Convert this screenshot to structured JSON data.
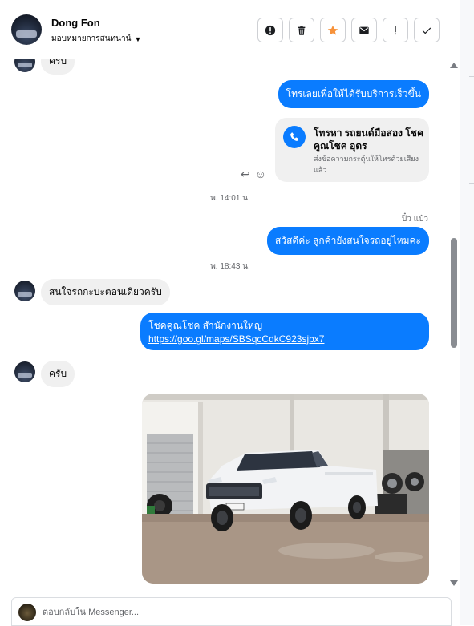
{
  "header": {
    "name": "Dong Fon",
    "assign_label": "มอบหมายการสนทนาน์",
    "tools": [
      {
        "icon": "alert-circle-icon",
        "glyph": "!"
      },
      {
        "icon": "trash-icon",
        "glyph": ""
      },
      {
        "icon": "star-icon",
        "glyph": "★",
        "color": "#f7923a"
      },
      {
        "icon": "mail-icon",
        "glyph": "✉"
      },
      {
        "icon": "exclamation-icon",
        "glyph": "!"
      },
      {
        "icon": "check-icon",
        "glyph": "✓"
      }
    ]
  },
  "messages": {
    "partial_top": "ครับ",
    "out_1": "โทรเลยเพื่อให้ได้รับบริการเร็วขึ้น",
    "call_card": {
      "title": "โทรหา รถยนต์มือสอง โชคคูณโชค อุดร",
      "subtitle": "ส่งข้อความกระตุ้นให้โทรด้วยเสียงแล้ว"
    },
    "stamp_1": "พ. 14:01 น.",
    "sender_1": "ปิ๋ว แป๋ว",
    "out_2": "สวัสดีค่ะ ลูกค้ายังสนใจรถอยู่ไหมคะ",
    "stamp_2": "พ. 18:43 น.",
    "in_1": "สนใจรถกะบะตอนเดียวครับ",
    "link_bubble": {
      "text": "โชคคูณโชค สำนักงานใหญ่",
      "url": "https://goo.gl/maps/SBSqcCdkC923sjbx7"
    },
    "in_2": "ครับ"
  },
  "composer": {
    "placeholder": "ตอบกลับใน Messenger..."
  },
  "colors": {
    "accent": "#0a7cff",
    "incoming_bg": "#f0f0f0",
    "star": "#f7923a"
  }
}
